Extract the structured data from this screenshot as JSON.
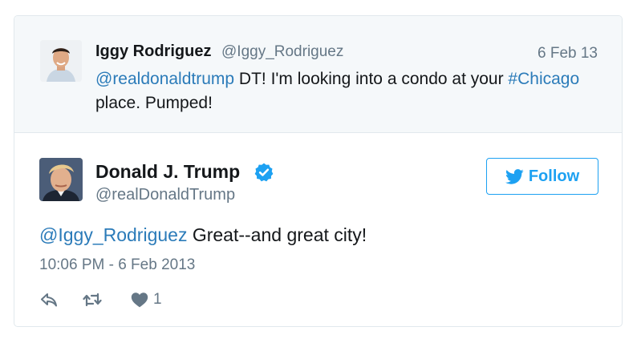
{
  "parent_tweet": {
    "name": "Iggy Rodriguez",
    "handle": "@Iggy_Rodriguez",
    "date": "6 Feb 13",
    "mention": "@realdonaldtrump",
    "text_part1": " DT! I'm looking into a condo at your ",
    "hashtag": "#Chicago",
    "text_part2": "place. Pumped!"
  },
  "tweet": {
    "name": "Donald J. Trump",
    "handle": "@realDonaldTrump",
    "mention": "@Iggy_Rodriguez",
    "text": " Great--and great city!",
    "timestamp": "10:06 PM - 6 Feb 2013",
    "likes": "1"
  },
  "follow_button": {
    "label": "Follow"
  },
  "icons": {
    "verified": "verified-badge-icon",
    "bird": "twitter-bird-icon",
    "reply": "reply-icon",
    "retweet": "retweet-icon",
    "like": "heart-icon"
  },
  "colors": {
    "link": "#2b7bb9",
    "accent": "#1da1f2",
    "muted": "#657786",
    "parent_bg": "#f5f8fa",
    "border": "#e1e8ed"
  }
}
